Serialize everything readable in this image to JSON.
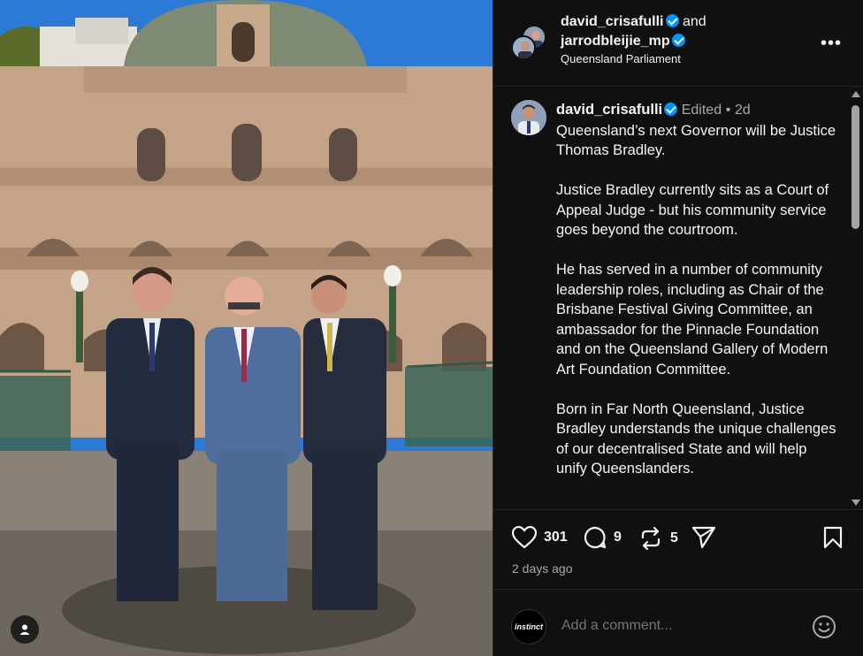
{
  "header": {
    "user1": "david_crisafulli",
    "and_text": "and",
    "user2": "jarrodbleijie_mp",
    "location": "Queensland Parliament"
  },
  "caption": {
    "username": "david_crisafulli",
    "edited": "Edited",
    "separator": "•",
    "age": "2d",
    "text": "Queensland’s next Governor will be Justice Thomas Bradley.\n\nJustice Bradley currently sits as a Court of Appeal Judge - but his community service goes beyond the courtroom.\n\nHe has served in a number of community leadership roles, including as Chair of the Brisbane Festival Giving Committee, an ambassador for the Pinnacle Foundation and on the Queensland Gallery of Modern Art Foundation Committee.\n\nBorn in Far North Queensland, Justice Bradley understands the unique challenges of our decentralised State and will help unify Queenslanders."
  },
  "actions": {
    "likes": "301",
    "comments": "9",
    "reposts": "5",
    "posted": "2 days ago"
  },
  "comment_box": {
    "avatar_text": "instinct",
    "placeholder": "Add a comment..."
  },
  "icons": {
    "like": "heart-icon",
    "comment": "comment-bubble-icon",
    "repost": "repost-icon",
    "share": "send-icon",
    "save": "bookmark-icon",
    "emoji": "smiley-icon",
    "more": "more-horizontal-icon",
    "tag": "user-tag-icon",
    "verified": "verified-badge-icon"
  },
  "colors": {
    "verified": "#0095f6",
    "background": "#101010",
    "muted": "#a8a8a8"
  }
}
